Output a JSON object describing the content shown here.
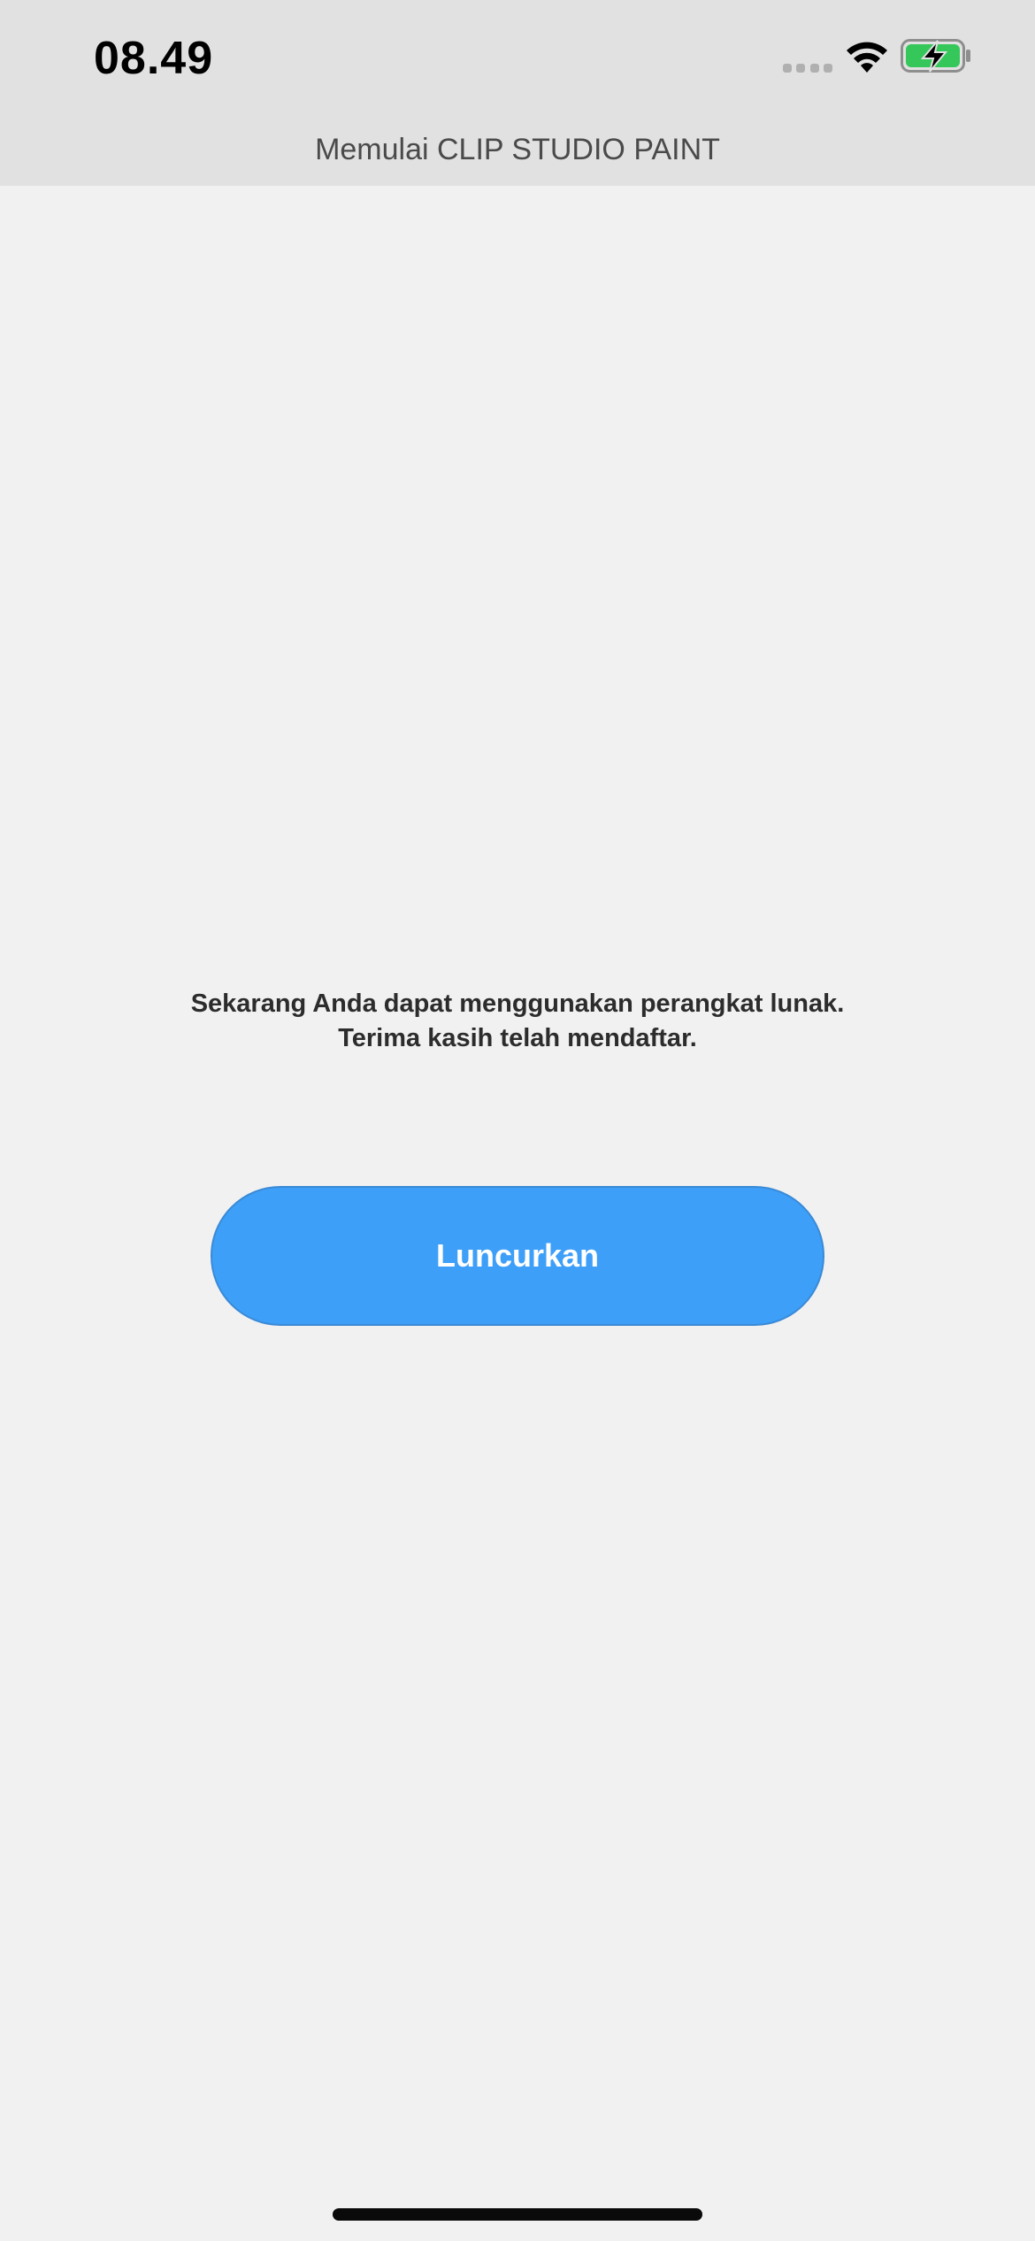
{
  "status_bar": {
    "time": "08.49",
    "icons": [
      "signal-icon",
      "wifi-icon",
      "battery-charging-icon"
    ],
    "battery_color": "#35c759"
  },
  "header": {
    "title": "Memulai CLIP STUDIO PAINT"
  },
  "main": {
    "message_line1": "Sekarang Anda dapat menggunakan perangkat lunak.",
    "message_line2": "Terima kasih telah mendaftar.",
    "launch_label": "Luncurkan",
    "accent_color": "#3d9ff8"
  }
}
